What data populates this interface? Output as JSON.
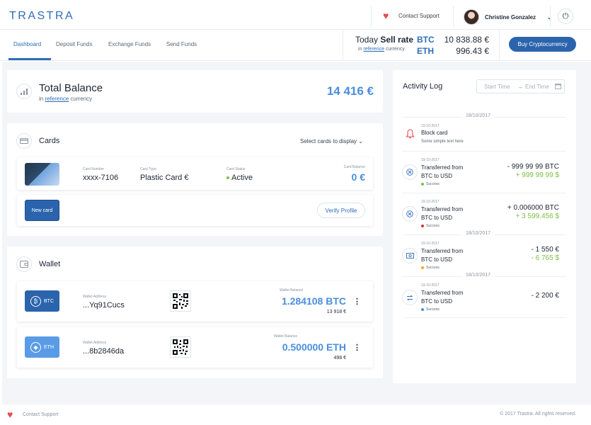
{
  "brand": {
    "logo": "TRASTRA"
  },
  "header": {
    "contact_support": "Contact Support",
    "user_name": "Christine Gonzalez"
  },
  "nav": {
    "tabs": [
      "Dashboard",
      "Deposit Funds",
      "Exchange Funds",
      "Send Funds"
    ],
    "active_tab": "Dashboard"
  },
  "rates": {
    "today": "Today",
    "sell_rate": "Sell rate",
    "in": "in",
    "reference": "reference",
    "currency": "currency",
    "btc_label": "BTC",
    "btc_value": "10 838.88 €",
    "eth_label": "ETH",
    "eth_value": "996.43 €"
  },
  "buy_button": "Buy Cryptocurrency",
  "total_balance": {
    "title": "Total Balance",
    "in": "in",
    "reference": "reference",
    "currency": "currency",
    "amount": "14 416 €"
  },
  "cards": {
    "title": "Cards",
    "select": "Select cards to display",
    "card_number_label": "Card Number",
    "card_number": "xxxx-7106",
    "card_type_label": "Card Type",
    "card_type": "Plastic Card €",
    "card_status_label": "Card Status",
    "card_status": "Active",
    "card_balance_label": "Card Balance",
    "card_balance": "0 €",
    "new_card": "New card",
    "verify_profile": "Verify Profile"
  },
  "wallet": {
    "title": "Wallet",
    "items": [
      {
        "coin": "BTC",
        "address_label": "Wallet Address",
        "address": "...Yq91Cucs",
        "balance_label": "Wallet Balance",
        "balance": "1.284108 BTC",
        "fiat": "13 918 €",
        "color": "#2b64ad"
      },
      {
        "coin": "ETH",
        "address_label": "Wallet Address",
        "address": "...8b2846da",
        "balance_label": "Wallet Balance",
        "balance": "0.500000 ETH",
        "fiat": "498 €",
        "color": "#5a9be6"
      }
    ]
  },
  "activity": {
    "title": "Activity Log",
    "start_time": "Start Time",
    "end_time": "End Time",
    "dates": [
      "18/10/2017",
      "18/10/2017",
      "18/10/2017"
    ],
    "items": [
      {
        "date": "19-10-2017",
        "title": "Block card",
        "desc": "Some simple text here"
      },
      {
        "date": "19-10-2017",
        "title1": "Transferred from",
        "title2": "BTC to USD",
        "status": "Success",
        "amount1": "- 999 99 99 BTC",
        "amount2": "+ 999 99 99 $",
        "status_color": "#7ac143"
      },
      {
        "date": "19-10-2017",
        "title1": "Transferred from",
        "title2": "BTC to USD",
        "status": "Success",
        "amount1": "+ 0.006000 BTC",
        "amount2": "+ 3 599.456 $",
        "status_color": "#d0342c"
      },
      {
        "date": "19-10-2017",
        "title1": "Transferred from",
        "title2": "BTC to USD",
        "status": "Success",
        "amount1": "- 1 550 €",
        "amount2": "- 6 765 $",
        "status_color": "#f5a623"
      },
      {
        "date": "19-10-2017",
        "title1": "Transferred from",
        "title2": "BTC to USD",
        "status": "Success",
        "amount1": "- 2 200 €",
        "status_color": "#4a8fdc"
      }
    ]
  },
  "footer": {
    "contact_support": "Contact Support",
    "copyright": "© 2017 Trastra. All rights reserved."
  },
  "colors": {
    "primary": "#2b64ad",
    "accent": "#4a8fdc",
    "positive": "#7ac143",
    "heart": "#e5484d"
  },
  "icons": [
    "heart-icon",
    "power-icon",
    "chevron-down-icon",
    "chart-icon",
    "card-icon",
    "wallet-icon",
    "bell-icon",
    "transfer-icon",
    "calendar-icon",
    "more-vertical-icon",
    "qr-code-icon",
    "bitcoin-icon",
    "ethereum-icon"
  ]
}
